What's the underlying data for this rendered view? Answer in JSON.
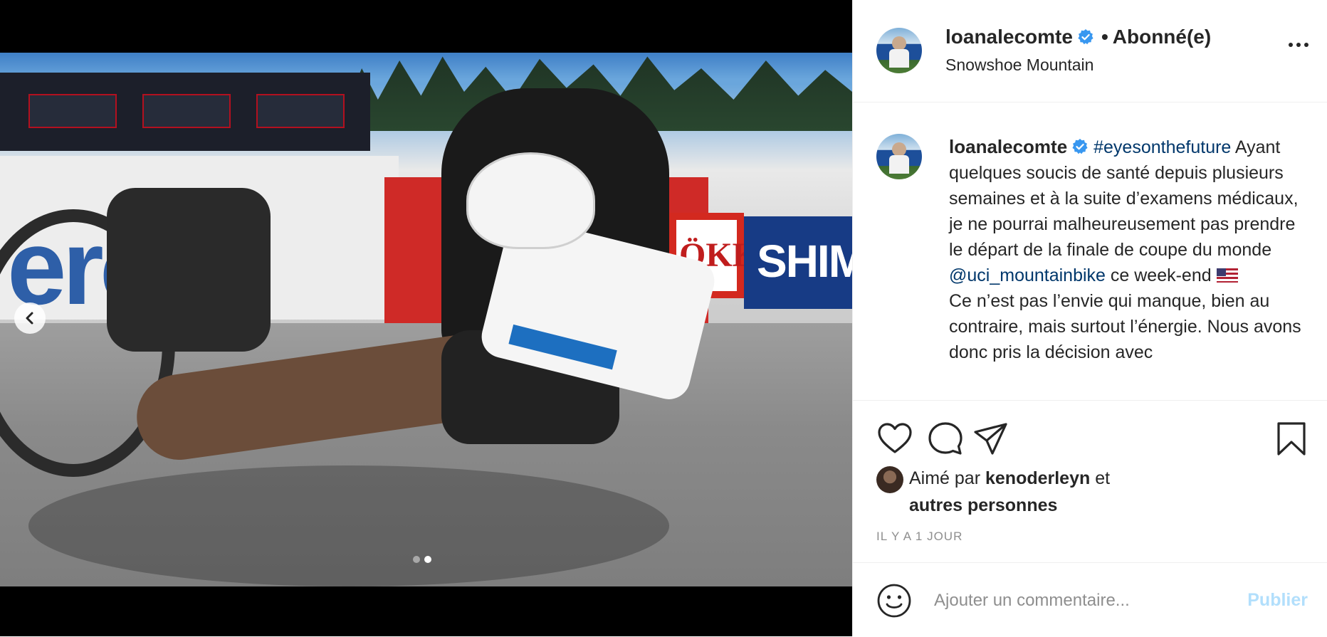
{
  "post": {
    "images": [
      {
        "index": 1
      },
      {
        "index": 2
      }
    ],
    "current_image": 2,
    "photo_text": {
      "wall": "ero",
      "sponsor_right": "SHIMA",
      "sponsor_mid": "ÖKK"
    }
  },
  "header": {
    "username": "loanalecomte",
    "verified": true,
    "follow_status": "Abonné(e)",
    "location": "Snowshoe Mountain"
  },
  "caption": {
    "username": "loanalecomte",
    "hashtag": "#eyesonthefuture",
    "body_1": "Ayant quelques soucis de santé depuis plusieurs semaines et à la suite d’examens médicaux, je ne pourrai malheureusement pas prendre le départ de la finale de coupe du monde",
    "mention": "@uci_mountainbike",
    "body_2": " ce week-end ",
    "body_3": "Ce n’est pas l’envie qui manque, bien au contraire, mais surtout l’énergie. Nous avons donc pris la décision avec"
  },
  "likes": {
    "prefix": "Aimé par ",
    "user": "kenoderleyn",
    "middle": " et",
    "suffix": "autres personnes"
  },
  "timestamp": "IL Y A 1 JOUR",
  "comment": {
    "placeholder": "Ajouter un commentaire...",
    "publish_label": "Publier"
  },
  "icons": {
    "like": "heart-icon",
    "comment": "speech-bubble-icon",
    "share": "paper-plane-icon",
    "save": "bookmark-icon",
    "more": "more-horizontal-icon",
    "emoji": "smiley-icon",
    "prev": "chevron-left-icon"
  },
  "colors": {
    "link": "#00376b",
    "verified": "#3897f0",
    "publish_disabled": "#b2dffc",
    "muted": "#8e8e8e"
  }
}
